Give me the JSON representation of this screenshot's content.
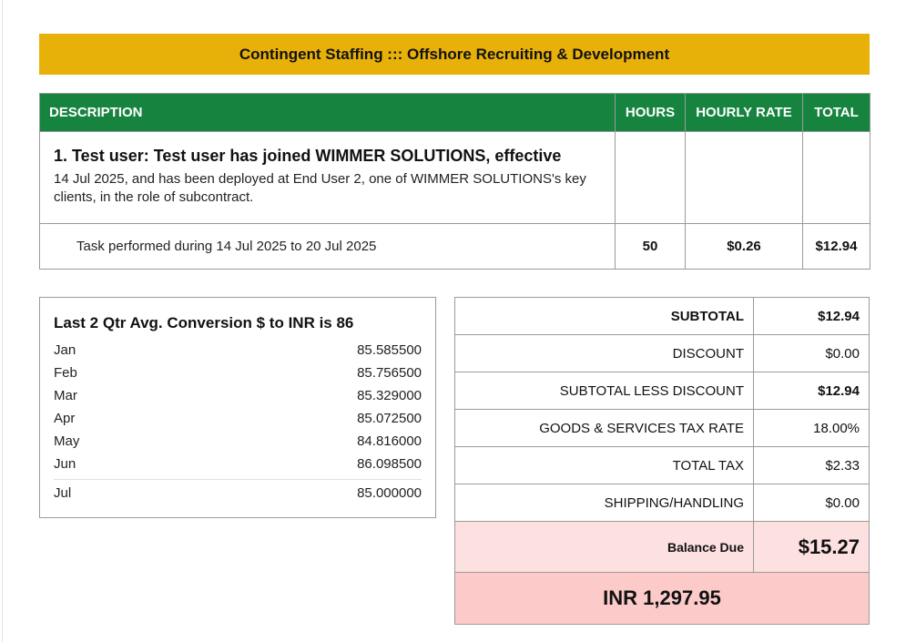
{
  "banner": {
    "title": "Contingent Staffing ::: Offshore Recruiting & Development"
  },
  "items_table": {
    "headers": {
      "description": "DESCRIPTION",
      "hours": "HOURS",
      "hourly_rate": "HOURLY RATE",
      "total": "TOTAL"
    },
    "item": {
      "title": "1. Test user: Test user has joined WIMMER SOLUTIONS, effective",
      "text": "14 Jul 2025, and has been deployed at End User 2, one of WIMMER SOLUTIONS's key clients, in the role of subcontract."
    },
    "task": {
      "description": "Task performed during 14 Jul 2025 to 20 Jul 2025",
      "hours": "50",
      "hourly_rate": "$0.26",
      "total": "$12.94"
    }
  },
  "conversion": {
    "title": "Last 2 Qtr Avg. Conversion $ to INR is 86",
    "rates": [
      {
        "month": "Jan",
        "value": "85.585500"
      },
      {
        "month": "Feb",
        "value": "85.756500"
      },
      {
        "month": "Mar",
        "value": "85.329000"
      },
      {
        "month": "Apr",
        "value": "85.072500"
      },
      {
        "month": "May",
        "value": "84.816000"
      },
      {
        "month": "Jun",
        "value": "86.098500"
      },
      {
        "month": "Jul",
        "value": "85.000000"
      }
    ]
  },
  "summary": {
    "subtotal": {
      "label": "SUBTOTAL",
      "value": "$12.94"
    },
    "discount": {
      "label": "DISCOUNT",
      "value": "$0.00"
    },
    "subtotal_less_discount": {
      "label": "SUBTOTAL LESS DISCOUNT",
      "value": "$12.94"
    },
    "tax_rate": {
      "label": "GOODS & SERVICES TAX RATE",
      "value": "18.00%"
    },
    "total_tax": {
      "label": "TOTAL TAX",
      "value": "$2.33"
    },
    "shipping": {
      "label": "SHIPPING/HANDLING",
      "value": "$0.00"
    },
    "balance_due": {
      "label": "Balance Due",
      "value": "$15.27"
    },
    "inr_total": "INR 1,297.95"
  },
  "colors": {
    "banner": "#e8b10a",
    "header_green": "#16843f",
    "balance_pink": "#fde0e0",
    "inr_pink": "#fdcaca"
  }
}
